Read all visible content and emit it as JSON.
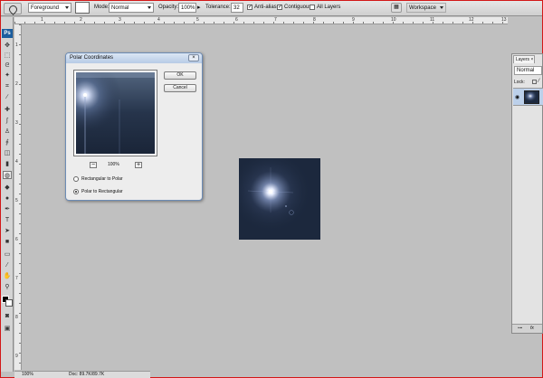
{
  "options_bar": {
    "preset": "Foreground",
    "mode_label": "Mode:",
    "mode_value": "Normal",
    "opacity_label": "Opacity:",
    "opacity_value": "100%",
    "tolerance_label": "Tolerance:",
    "tolerance_value": "32",
    "antialias_label": "Anti-alias",
    "antialias_checked": true,
    "contiguous_label": "Contiguous",
    "contiguous_checked": true,
    "all_layers_label": "All Layers",
    "all_layers_checked": false,
    "workspace_label": "Workspace"
  },
  "tools_panel": {
    "logo": "Ps",
    "tools": [
      "move-icon",
      "marquee-icon",
      "lasso-icon",
      "magic-wand-icon",
      "crop-icon",
      "eyedropper-icon",
      "healing-icon",
      "brush-icon",
      "stamp-icon",
      "history-brush-icon",
      "eraser-icon",
      "gradient-icon",
      "blur-icon",
      "dodge-icon",
      "pen-icon",
      "type-icon",
      "path-select-icon",
      "shape-icon",
      "notes-icon",
      "eyedropper2-icon",
      "hand-icon",
      "zoom-icon"
    ]
  },
  "ruler": {
    "top_numbers": [
      "1",
      "2",
      "3",
      "4",
      "5",
      "6",
      "7",
      "8",
      "9",
      "10",
      "11",
      "12",
      "13"
    ],
    "left_numbers": [
      "1",
      "2",
      "3",
      "4",
      "5",
      "6",
      "7",
      "8",
      "9"
    ]
  },
  "dialog": {
    "title": "Polar Coordinates",
    "ok_label": "OK",
    "cancel_label": "Cancel",
    "zoom_minus": "−",
    "zoom_value": "100%",
    "zoom_plus": "+",
    "option1": "Rectangular to Polar",
    "option2": "Polar to Rectangular",
    "selected": 2
  },
  "layers_panel": {
    "tab_label": "Layers",
    "blend_mode": "Normal",
    "lock_label": "Lock:"
  },
  "status_bar": {
    "zoom": "100%",
    "doc_info": "Doc: 89.7K/89.7K"
  },
  "colors": {
    "canvas_bg": "#c0c0c0",
    "image_bg": "#1d2a40",
    "selection": "#bcd0ea",
    "accent_red": "#d21818"
  }
}
